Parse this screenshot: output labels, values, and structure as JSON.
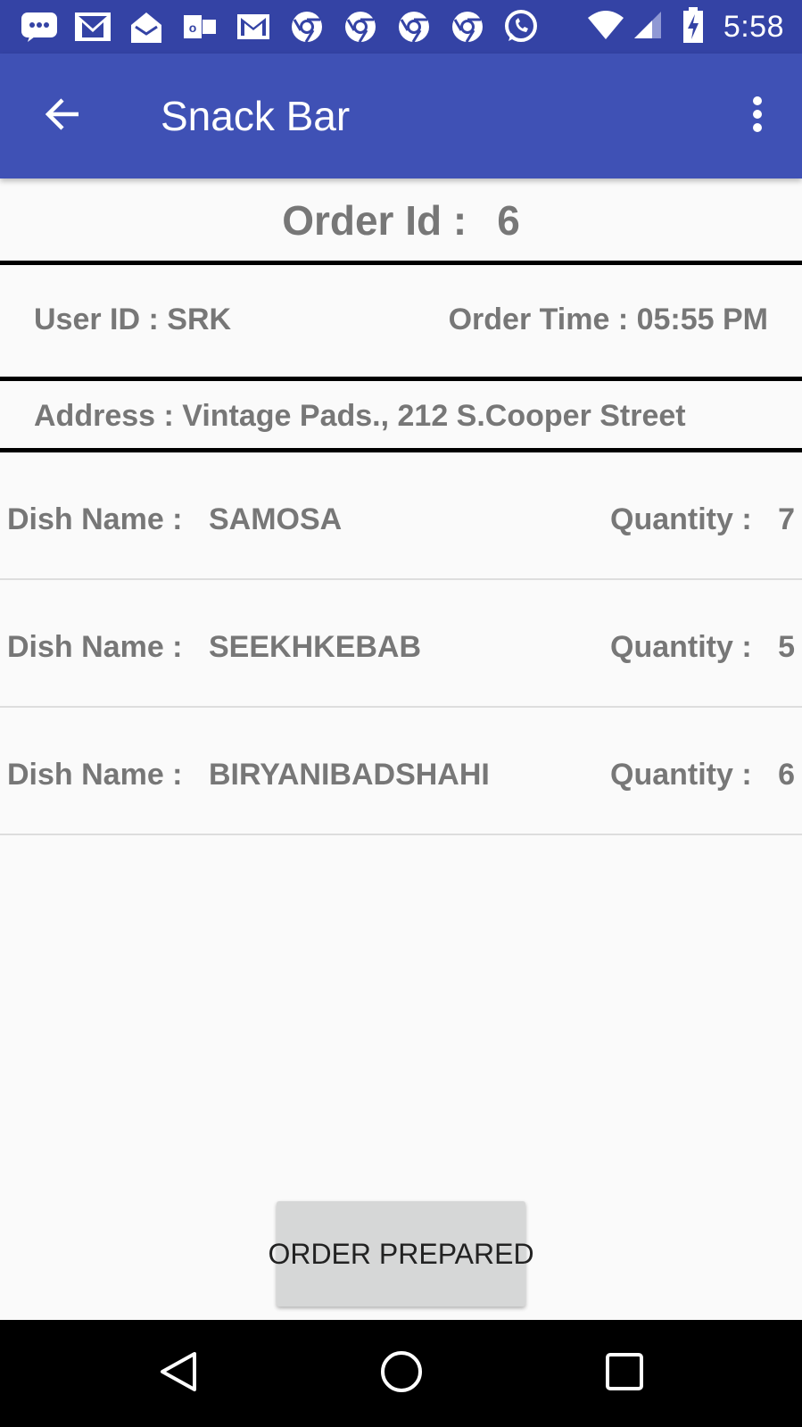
{
  "status_bar": {
    "time": "5:58",
    "notification_icons": [
      "messages-icon",
      "gmail-icon",
      "inbox-icon",
      "outlook-icon",
      "gmail-icon",
      "chrome-icon",
      "chrome-icon",
      "chrome-icon",
      "chrome-icon",
      "whatsapp-icon"
    ],
    "system_icons": [
      "wifi-icon",
      "signal-icon",
      "battery-charging-icon"
    ]
  },
  "app_bar": {
    "title": "Snack Bar",
    "back_icon": "back-arrow-icon",
    "menu_icon": "more-vert-icon"
  },
  "order": {
    "id_label": "Order Id :",
    "id_value": "6",
    "user_id_text": "User ID : SRK",
    "order_time_text": "Order Time : 05:55 PM",
    "address_text": "Address : Vintage Pads., 212 S.Cooper Street"
  },
  "dishes": [
    {
      "dish_label": "Dish Name :",
      "dish_name": "SAMOSA",
      "qty_label": "Quantity :",
      "qty": "7"
    },
    {
      "dish_label": "Dish Name :",
      "dish_name": "SEEKHKEBAB",
      "qty_label": "Quantity :",
      "qty": "5"
    },
    {
      "dish_label": "Dish Name :",
      "dish_name": "BIRYANIBADSHAHI",
      "qty_label": "Quantity :",
      "qty": "6"
    }
  ],
  "actions": {
    "order_prepared_label": "ORDER PREPARED"
  },
  "nav_bar": {
    "icons": [
      "nav-back-icon",
      "nav-home-icon",
      "nav-recents-icon"
    ]
  },
  "colors": {
    "status_bar": "#3443a5",
    "app_bar": "#3f51b5",
    "text_gray": "#777777",
    "button_bg": "#d6d7d7"
  }
}
